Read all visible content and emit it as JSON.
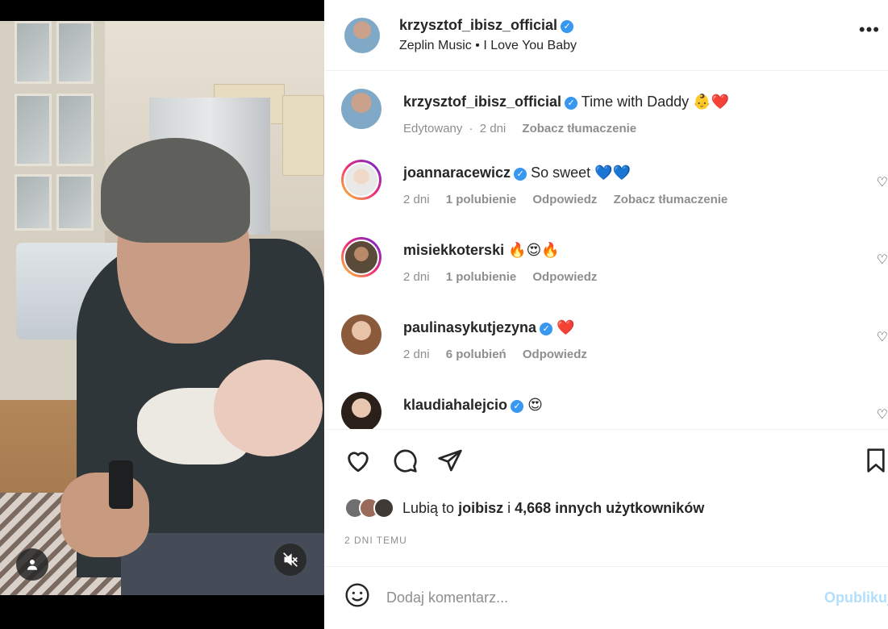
{
  "media": {
    "icons": {
      "user_tag": "person-icon",
      "mute": "muted-speaker-icon"
    }
  },
  "header": {
    "username": "krzysztof_ibisz_official",
    "audio_artist": "Zeplin Music",
    "audio_separator": "•",
    "audio_title": "I Love You Baby",
    "more": "•••"
  },
  "caption": {
    "username": "krzysztof_ibisz_official",
    "text": "Time with Daddy",
    "emoji": "👶❤️",
    "edited": "Edytowany",
    "age": "2 dni",
    "translate": "Zobacz tłumaczenie"
  },
  "comments": [
    {
      "username": "joannaracewicz",
      "verified": true,
      "text": "So sweet 💙💙",
      "age": "2 dni",
      "likes": "1 polubienie",
      "reply": "Odpowiedz",
      "translate": "Zobacz tłumaczenie"
    },
    {
      "username": "misiekkoterski",
      "verified": false,
      "text": "🔥😍🔥",
      "age": "2 dni",
      "likes": "1 polubienie",
      "reply": "Odpowiedz"
    },
    {
      "username": "paulinasykutjezyna",
      "verified": true,
      "text": "❤️",
      "age": "2 dni",
      "likes": "6 polubień",
      "reply": "Odpowiedz"
    },
    {
      "username": "klaudiahalejcio",
      "verified": true,
      "text": "😍"
    }
  ],
  "likes": {
    "prefix": "Lubią to",
    "user": "joibisz",
    "connector": "i",
    "others": "4,668 innych użytkowników"
  },
  "date": "2 DNI TEMU",
  "add_comment": {
    "placeholder": "Dodaj komentarz...",
    "publish": "Opublikuj"
  },
  "colors": {
    "verified": "#3897f0",
    "link_disabled": "#b2dffc",
    "secondary_text": "#8e8e8e"
  }
}
